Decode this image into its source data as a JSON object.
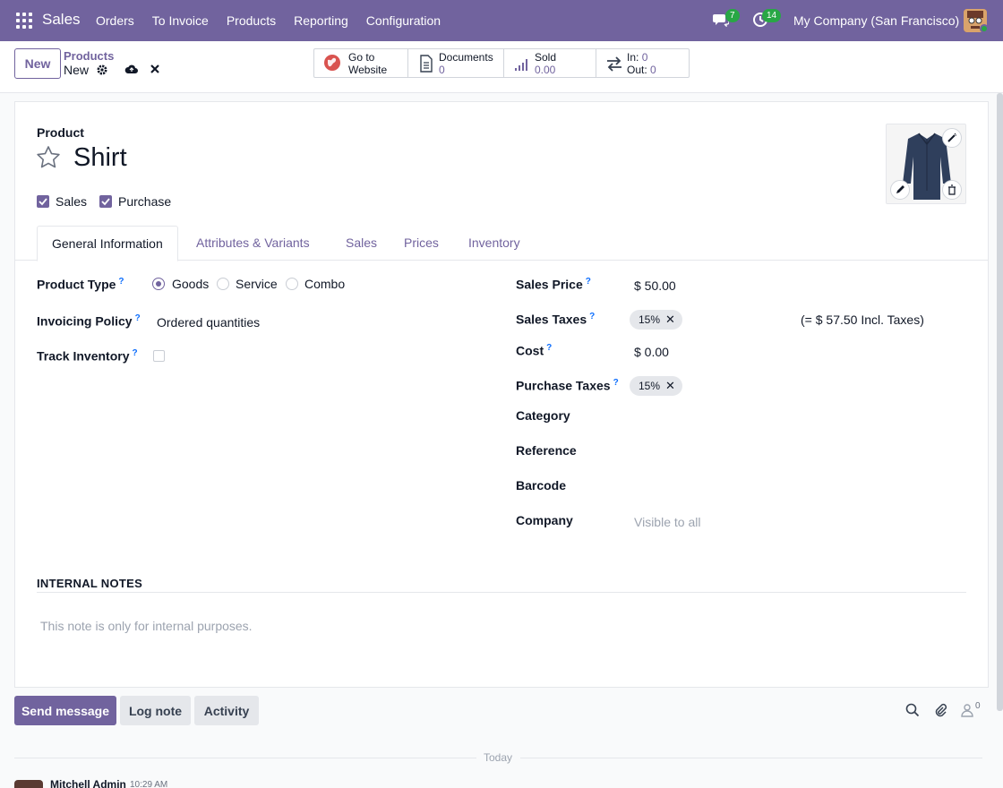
{
  "navbar": {
    "app_name": "Sales",
    "menu": [
      "Orders",
      "To Invoice",
      "Products",
      "Reporting",
      "Configuration"
    ],
    "messages_count": "7",
    "activities_count": "14",
    "company": "My Company (San Francisco)"
  },
  "control": {
    "new_label": "New",
    "breadcrumb_parent": "Products",
    "breadcrumb_current": "New",
    "stats": [
      {
        "label": "Go to",
        "label2": "Website",
        "icon": "globe-icon"
      },
      {
        "label": "Documents",
        "value": "0",
        "icon": "document-icon"
      },
      {
        "label": "Sold",
        "value": "0.00",
        "icon": "chart-bars-icon"
      },
      {
        "label": "In:",
        "value": "0",
        "label2": "Out:",
        "value2": "0",
        "icon": "transfer-arrows-icon"
      }
    ]
  },
  "form": {
    "product_label": "Product",
    "product_name": "Shirt",
    "sales_checkbox": "Sales",
    "purchase_checkbox": "Purchase",
    "tabs": [
      "General Information",
      "Attributes & Variants",
      "Sales",
      "Prices",
      "Inventory"
    ],
    "left": {
      "product_type_label": "Product Type",
      "product_type_options": [
        "Goods",
        "Service",
        "Combo"
      ],
      "product_type_selected": "Goods",
      "invoicing_policy_label": "Invoicing Policy",
      "invoicing_policy_value": "Ordered quantities",
      "track_inventory_label": "Track Inventory"
    },
    "right": {
      "sales_price_label": "Sales Price",
      "sales_price_value": "$ 50.00",
      "sales_taxes_label": "Sales Taxes",
      "sales_taxes_tag": "15%",
      "incl_taxes": "(= $ 57.50 Incl. Taxes)",
      "cost_label": "Cost",
      "cost_value": "$ 0.00",
      "purchase_taxes_label": "Purchase Taxes",
      "purchase_taxes_tag": "15%",
      "category_label": "Category",
      "reference_label": "Reference",
      "barcode_label": "Barcode",
      "company_label": "Company",
      "company_placeholder": "Visible to all"
    },
    "notes_title": "INTERNAL NOTES",
    "notes_placeholder": "This note is only for internal purposes."
  },
  "chatter": {
    "send_message": "Send message",
    "log_note": "Log note",
    "activity": "Activity",
    "followers_count": "0",
    "today_label": "Today",
    "author": "Mitchell Admin",
    "time": "10:29 AM"
  },
  "colors": {
    "brand": "#71639e",
    "badge": "#28a745"
  }
}
